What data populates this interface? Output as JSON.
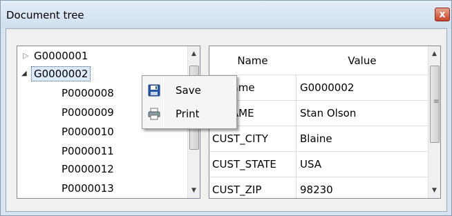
{
  "window": {
    "title": "Document tree",
    "close_glyph": "x"
  },
  "tree": {
    "items": [
      {
        "label": "G0000001",
        "expander": "▷"
      },
      {
        "label": "G0000002",
        "expander": "◢"
      },
      {
        "label": "P0000008"
      },
      {
        "label": "P0000009"
      },
      {
        "label": "P0000010"
      },
      {
        "label": "P0000011"
      },
      {
        "label": "P0000012"
      },
      {
        "label": "P0000013"
      }
    ],
    "scroll_up": "▲",
    "scroll_down": "▼"
  },
  "grid": {
    "headers": [
      "Name",
      "Value"
    ],
    "rows": [
      {
        "name": "upname",
        "value": "G0000002"
      },
      {
        "name": "T_NAME",
        "value": "Stan Olson"
      },
      {
        "name": "CUST_CITY",
        "value": "Blaine"
      },
      {
        "name": "CUST_STATE",
        "value": "USA"
      },
      {
        "name": "CUST_ZIP",
        "value": "98230"
      }
    ],
    "scroll_up": "▲",
    "scroll_down": "▼",
    "scroll_grip": "≡"
  },
  "context_menu": {
    "items": [
      {
        "label": "Save",
        "icon": "floppy-disk-icon"
      },
      {
        "label": "Print",
        "icon": "printer-icon"
      }
    ]
  }
}
